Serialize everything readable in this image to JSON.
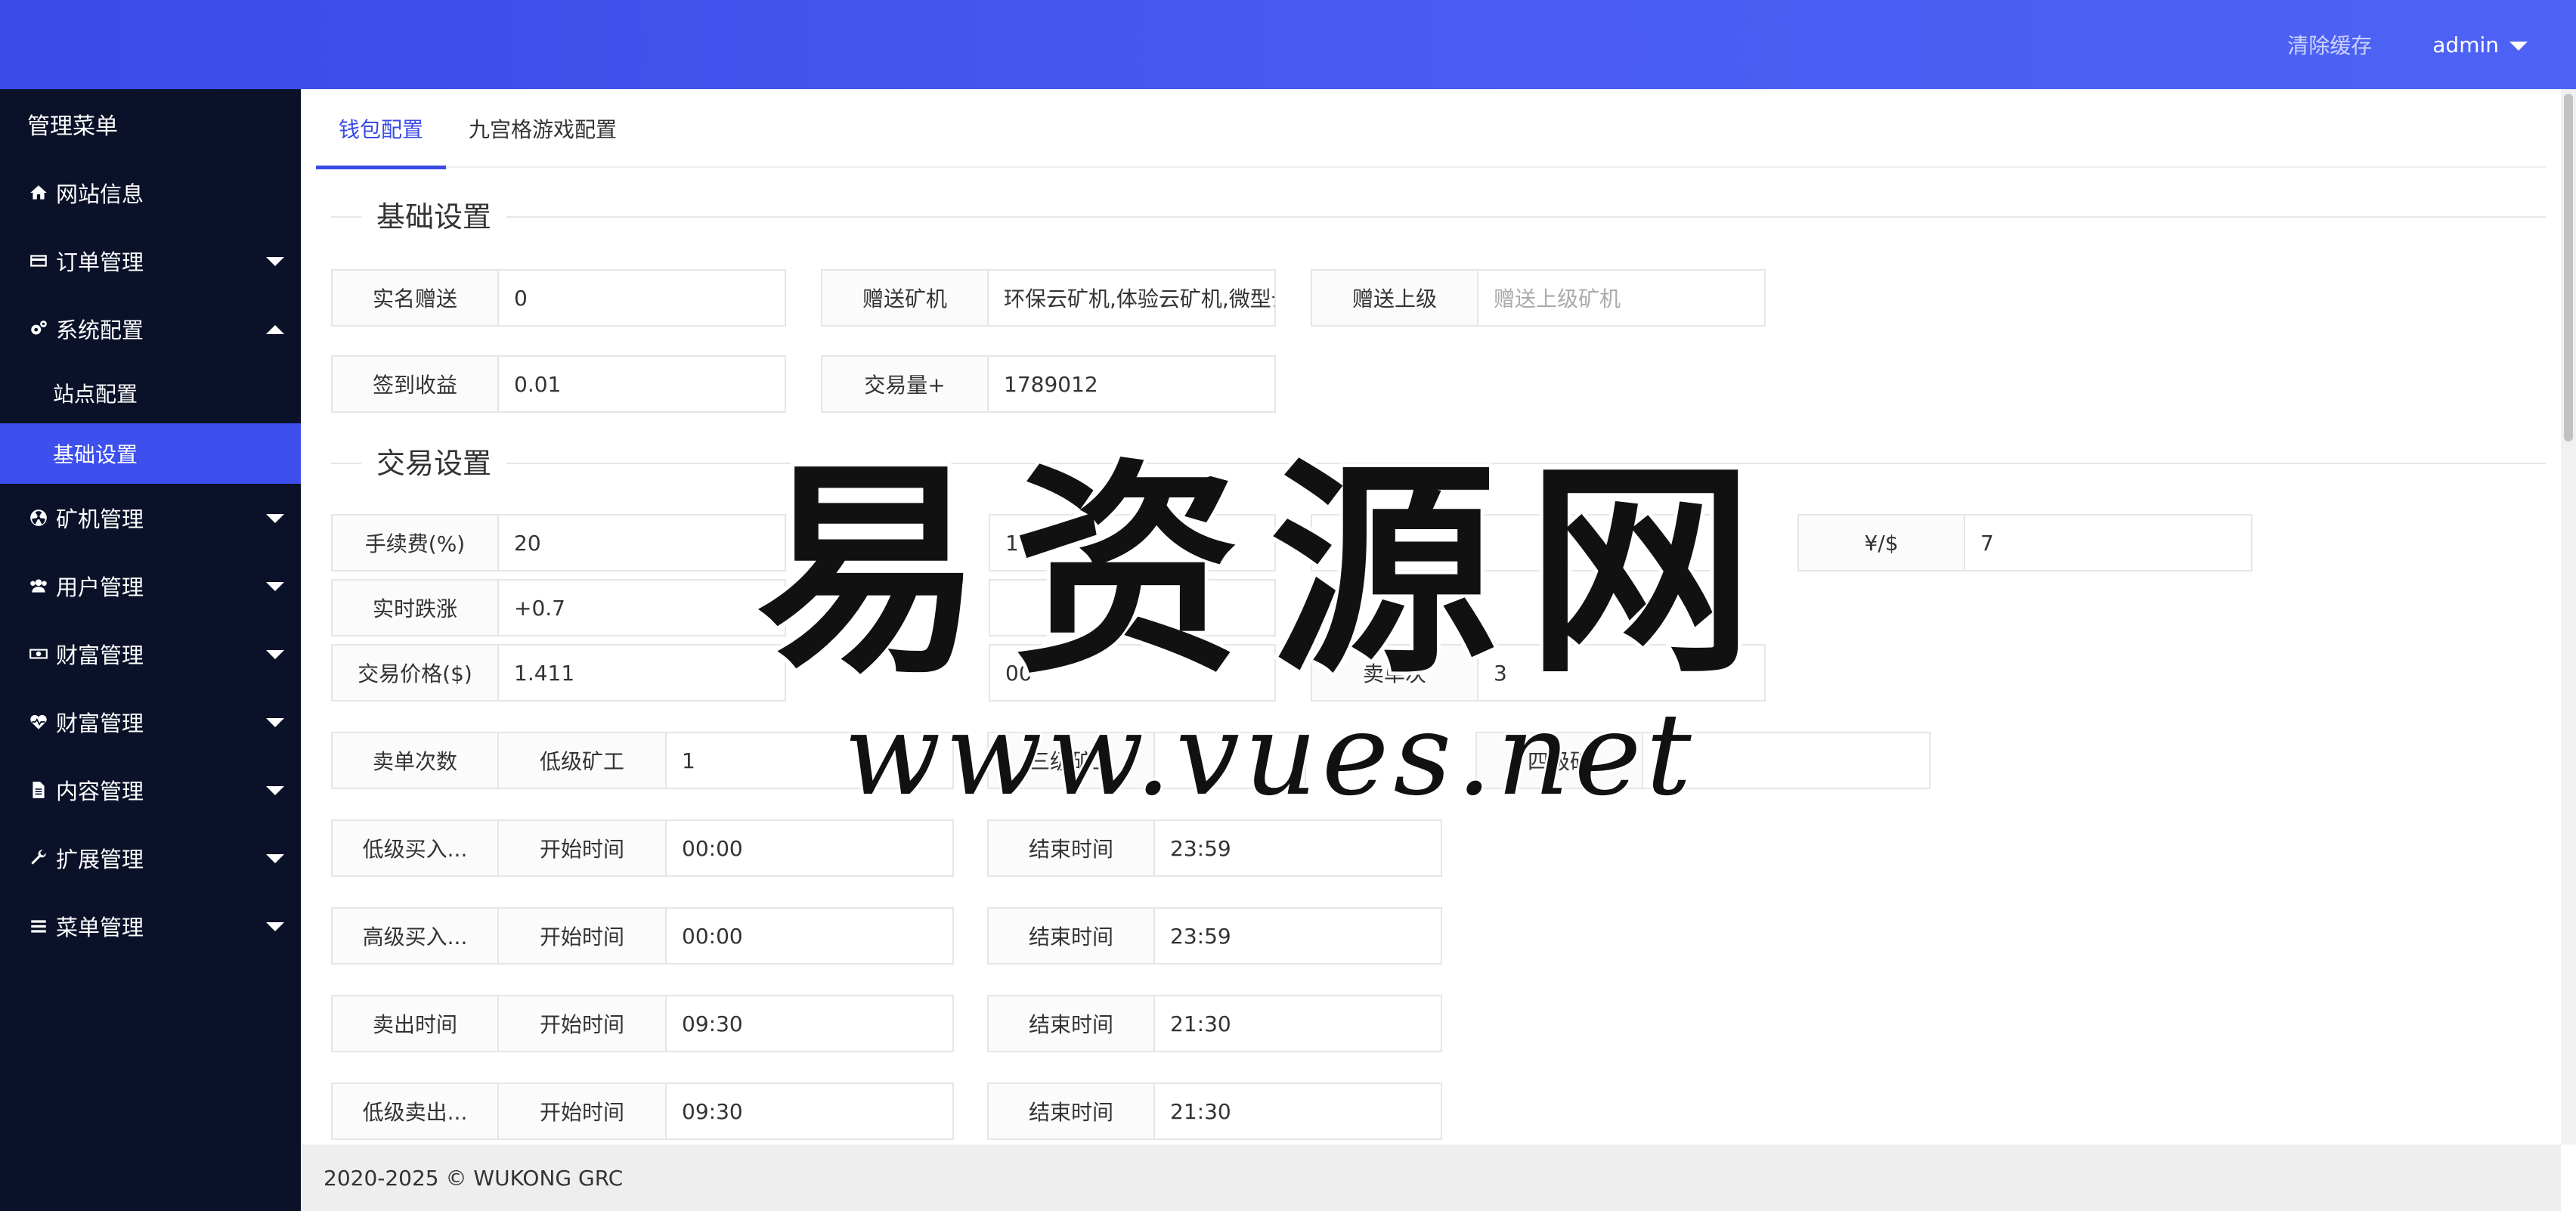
{
  "header": {
    "clear_cache": "清除缓存",
    "user": "admin"
  },
  "sidebar": {
    "title": "管理菜单",
    "items": [
      {
        "label": "网站信息",
        "icon": "home-icon",
        "arrow": "none"
      },
      {
        "label": "订单管理",
        "icon": "credit-card-icon",
        "arrow": "down"
      },
      {
        "label": "系统配置",
        "icon": "gears-icon",
        "arrow": "up"
      },
      {
        "label": "矿机管理",
        "icon": "radiation-icon",
        "arrow": "down"
      },
      {
        "label": "用户管理",
        "icon": "users-icon",
        "arrow": "down"
      },
      {
        "label": "财富管理",
        "icon": "money-icon",
        "arrow": "down"
      },
      {
        "label": "财富管理",
        "icon": "heartbeat-icon",
        "arrow": "down"
      },
      {
        "label": "内容管理",
        "icon": "file-icon",
        "arrow": "down"
      },
      {
        "label": "扩展管理",
        "icon": "wrench-icon",
        "arrow": "down"
      },
      {
        "label": "菜单管理",
        "icon": "bars-icon",
        "arrow": "down"
      }
    ],
    "sub_items": [
      {
        "label": "站点配置",
        "active": false
      },
      {
        "label": "基础设置",
        "active": true
      }
    ]
  },
  "tabs": [
    {
      "label": "钱包配置",
      "active": true
    },
    {
      "label": "九宫格游戏配置",
      "active": false
    }
  ],
  "sections": {
    "basic": "基础设置",
    "trade": "交易设置"
  },
  "basic_fields": {
    "realname_gift": {
      "label": "实名赠送",
      "value": "0"
    },
    "gift_miner": {
      "label": "赠送矿机",
      "value": "环保云矿机,体验云矿机,微型云矿机"
    },
    "gift_parent": {
      "label": "赠送上级",
      "placeholder": "赠送上级矿机"
    },
    "signin_income": {
      "label": "签到收益",
      "value": "0.01"
    },
    "trade_volume": {
      "label": "交易量+",
      "value": "1789012"
    }
  },
  "trade_fields": {
    "fee": {
      "label": "手续费(%)",
      "value": "20"
    },
    "row1_b_value": "10",
    "rate": {
      "label": "¥/$",
      "value": "7"
    },
    "change": {
      "label": "实时跌涨",
      "value": "+0.7"
    },
    "price": {
      "label": "交易价格($)",
      "value": "1.411"
    },
    "row3_b_value": "00",
    "sell_times_partial": {
      "label": "卖单次",
      "value": "3"
    },
    "sell_count": {
      "label": "卖单次数",
      "low_label": "低级矿工",
      "low_value": "1",
      "third_label": "三级矿工",
      "fourth_label": "四级矿"
    },
    "low_buy": {
      "label": "低级买入...",
      "start_label": "开始时间",
      "start": "00:00",
      "end_label": "结束时间",
      "end": "23:59"
    },
    "high_buy": {
      "label": "高级买入...",
      "start_label": "开始时间",
      "start": "00:00",
      "end_label": "结束时间",
      "end": "23:59"
    },
    "sell_time": {
      "label": "卖出时间",
      "start_label": "开始时间",
      "start": "09:30",
      "end_label": "结束时间",
      "end": "21:30"
    },
    "low_sell": {
      "label": "低级卖出...",
      "start_label": "开始时间",
      "start": "09:30",
      "end_label": "结束时间",
      "end": "21:30"
    }
  },
  "watermark": {
    "text": "易资源网",
    "url": "www.vues.net"
  },
  "footer": {
    "text": "2020-2025 © WUKONG GRC"
  },
  "colors": {
    "header": "#3a4ae6",
    "sidebar": "#0a1128",
    "active": "#3d50ee"
  }
}
